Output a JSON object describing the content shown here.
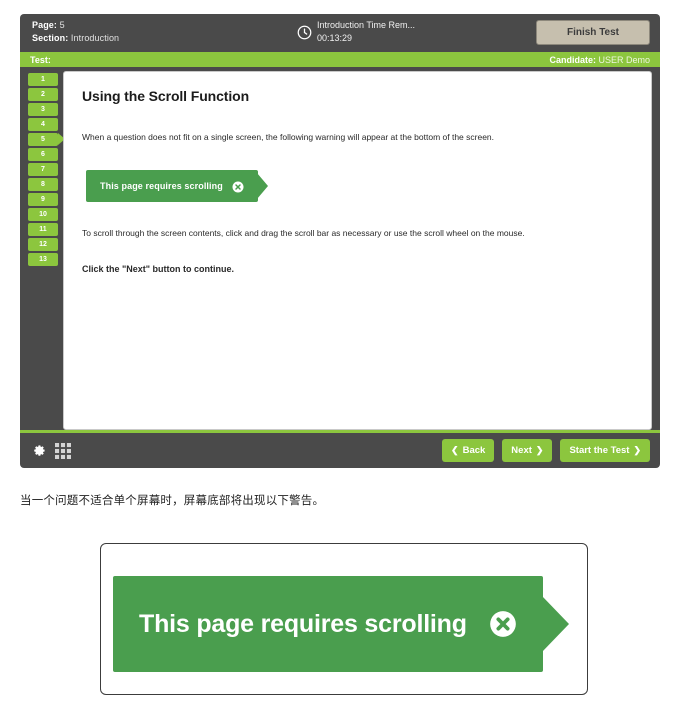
{
  "exam_app": {
    "header": {
      "page_label": "Page:",
      "page_value": "5",
      "section_label": "Section:",
      "section_value": "Introduction",
      "timer_icon": "clock-icon",
      "timer_title": "Introduction Time Rem...",
      "timer_value": "00:13:29",
      "finish_button": "Finish Test"
    },
    "subheader": {
      "test_label": "Test:",
      "test_value": "",
      "candidate_label": "Candidate:",
      "candidate_value": "USER Demo"
    },
    "nav_rail": {
      "items": [
        "1",
        "2",
        "3",
        "4",
        "5",
        "6",
        "7",
        "8",
        "9",
        "10",
        "11",
        "12",
        "13"
      ],
      "active_index": 4
    },
    "content": {
      "title": "Using the Scroll Function",
      "paragraph_1": "When a question does not fit on a single screen, the following warning will appear at the bottom of the screen.",
      "banner_text": "This page requires scrolling",
      "banner_close_icon": "close-circle-icon",
      "paragraph_2": "To scroll through the screen contents, click and drag the scroll bar as necessary or use the scroll wheel on the mouse.",
      "paragraph_3": "Click the \"Next\" button to continue."
    },
    "footer": {
      "settings_icon": "gear-icon",
      "grid_icon": "grid-menu-icon",
      "back_button": "Back",
      "back_chevron": "❮",
      "next_button": "Next",
      "next_chevron": "❯",
      "start_button": "Start the Test",
      "start_chevron": "❯"
    }
  },
  "caption": {
    "text": "当一个问题不适合单个屏幕时，屏幕底部将出现以下警告。"
  },
  "detail_card": {
    "banner_text": "This page requires scrolling",
    "close_icon": "close-circle-icon"
  },
  "colors": {
    "brand_green": "#8cc63e",
    "banner_green": "#4a9e4e",
    "dark_chrome": "#4a4a4a",
    "finish_beige": "#c6bfae"
  }
}
